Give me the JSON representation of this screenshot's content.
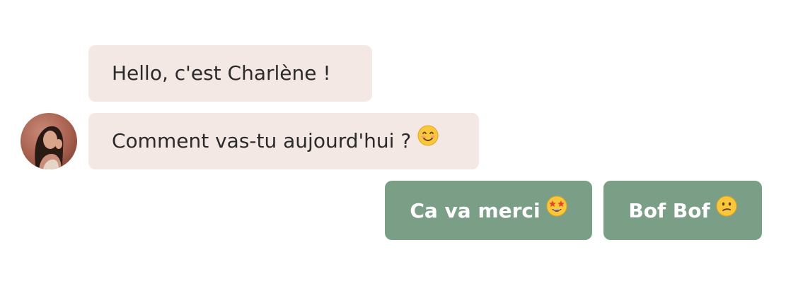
{
  "chat": {
    "messages": [
      {
        "text": "Hello, c'est Charlène !"
      },
      {
        "text": "Comment vas-tu aujourd'hui ?",
        "emoji": "smiling-face-with-smiling-eyes-icon"
      }
    ],
    "avatar": {
      "icon": "avatar-photo"
    },
    "quick_replies": [
      {
        "label": "Ca va merci",
        "emoji": "star-struck-face-icon"
      },
      {
        "label": "Bof Bof",
        "emoji": "confused-face-icon"
      }
    ]
  },
  "colors": {
    "bot_bubble_bg": "#f4e8e5",
    "reply_button_bg": "#7a9f86",
    "text_dark": "#2b2b2b",
    "text_light": "#ffffff"
  }
}
